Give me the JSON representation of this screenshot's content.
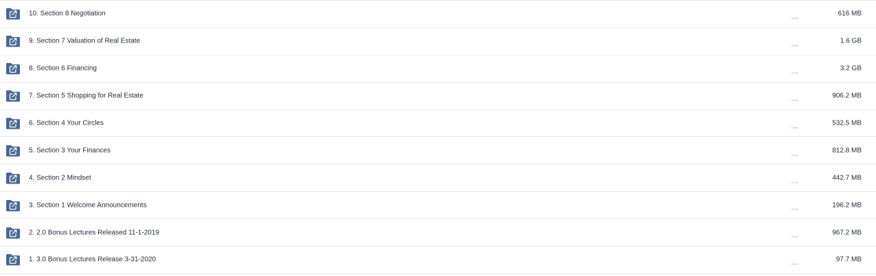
{
  "colors": {
    "folder": "#4a6791",
    "text": "#1e2a3a",
    "divider": "#e9e9e9",
    "more_dots": "#b9bcc2"
  },
  "icons": {
    "row_icon": "shared-folder-icon",
    "overflow": "more-options-icon"
  },
  "items": [
    {
      "name": "10. Section 8 Negotiation",
      "size": "616 MB"
    },
    {
      "name": "9. Section 7 Valuation of Real Estate",
      "size": "1.6 GB"
    },
    {
      "name": "8. Section 6 Financing",
      "size": "3.2 GB"
    },
    {
      "name": "7. Section 5 Shopping for Real Estate",
      "size": "906.2 MB"
    },
    {
      "name": "6. Section 4 Your Circles",
      "size": "532.5 MB"
    },
    {
      "name": "5. Section 3 Your Finances",
      "size": "812.8 MB"
    },
    {
      "name": "4. Section 2 Mindset",
      "size": "442.7 MB"
    },
    {
      "name": "3. Section 1 Welcome Announcements",
      "size": "196.2 MB"
    },
    {
      "name": "2. 2.0 Bonus Lectures Released 11-1-2019",
      "size": "967.2 MB"
    },
    {
      "name": "1. 3.0 Bonus Lectures Release 3-31-2020",
      "size": "97.7 MB"
    }
  ]
}
